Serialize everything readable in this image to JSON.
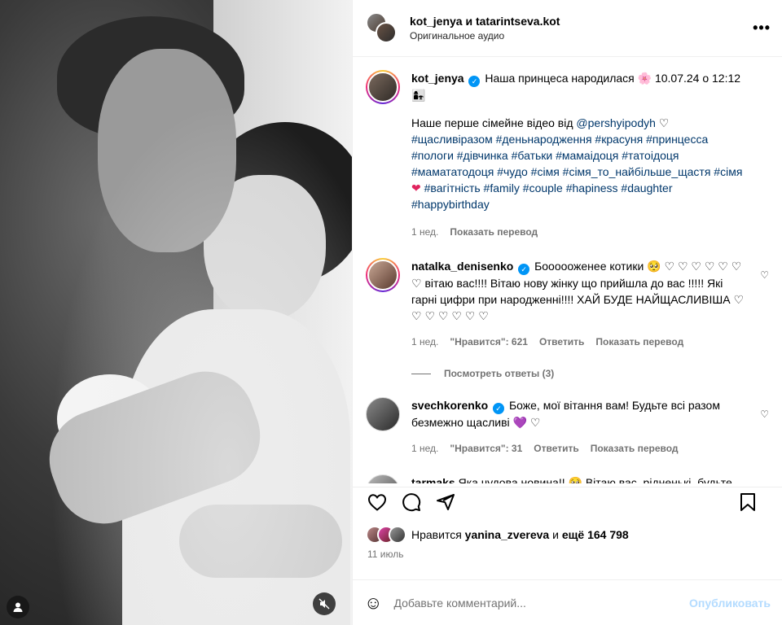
{
  "header": {
    "names": "kot_jenya и tatarintseva.kot",
    "subtitle": "Оригинальное аудио",
    "more": "•••"
  },
  "caption": {
    "username": "kot_jenya",
    "headline": "Наша принцеса народилася 🌸 10.07.24 о 12:12 👩‍👧",
    "body_text": "Наше перше сімейне відео від ",
    "mention": "@pershyipodyh",
    "hashtags_1": "#щасливіразом #деньнародження #красуня #принцесса #пологи #дівчинка #батьки #мамаідоця #татоідоця #мамататодоця #чудо #сімя #сімя_то_найбільше_щастя #сімя",
    "heart": "❤",
    "hashtags_2": " #вагітність #family #couple #hapiness #daughter #happybirthday",
    "age": "1 нед.",
    "translate": "Показать перевод"
  },
  "comments": [
    {
      "username": "natalka_denisenko",
      "text": "Боооооженее котики 🥺 ♡ ♡ ♡ ♡ ♡ ♡ ♡ вітаю вас!!!! Вітаю нову жінку що прийшла до вас !!!!! Які гарні цифри при народженні!!!! ХАЙ БУДЕ НАЙЩАСЛИВІША ♡ ♡ ♡ ♡ ♡ ♡ ♡",
      "age": "1 нед.",
      "likes": "\"Нравится\": 621",
      "reply": "Ответить",
      "translate": "Показать перевод",
      "replies": "Посмотреть ответы (3)"
    },
    {
      "username": "svechkorenko",
      "text": "Боже, мої вітання вам! Будьте всі разом безмежно щасливі 💜 ♡",
      "age": "1 нед.",
      "likes": "\"Нравится\": 31",
      "reply": "Ответить",
      "translate": "Показать перевод"
    },
    {
      "username": "tarmaks",
      "text": "Яка чудова новина!! 🥺 Вітаю вас, рідненькі, будьте всі здорові та щасливі разом ❤️"
    }
  ],
  "likes": {
    "prefix": "Нравится ",
    "user": "yanina_zvereva",
    "middle": " и ",
    "rest": "ещё 164 798"
  },
  "date": "11 июль",
  "composer": {
    "placeholder": "Добавьте комментарий...",
    "post": "Опубликовать",
    "emoji": "☺"
  },
  "icons": [
    "like-icon",
    "comment-icon",
    "share-icon",
    "save-icon",
    "user-tag-icon",
    "mute-icon",
    "emoji-icon",
    "more-icon",
    "verified-icon"
  ]
}
